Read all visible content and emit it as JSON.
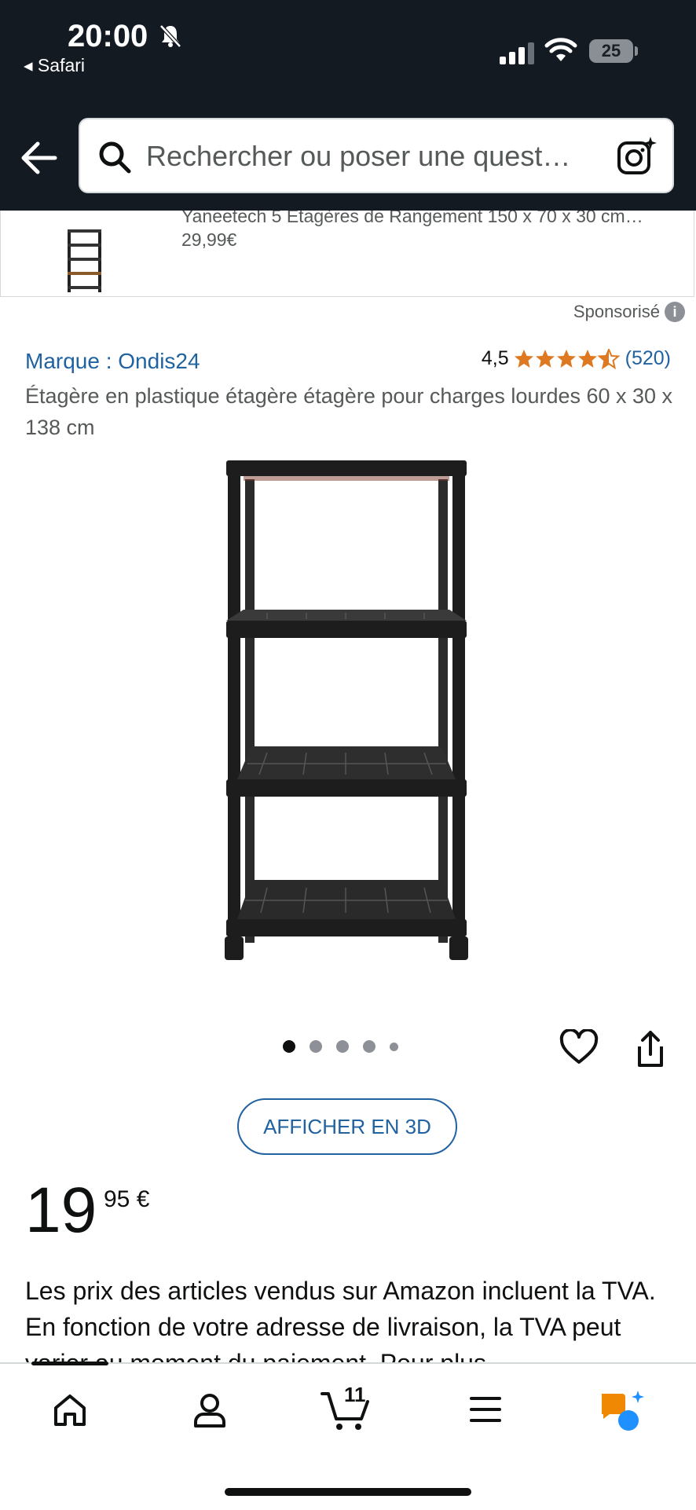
{
  "status_bar": {
    "time": "20:00",
    "back_app": "◂ Safari",
    "battery": "25"
  },
  "header": {
    "search_placeholder": "Rechercher ou poser une quest…"
  },
  "sponsored_strip": {
    "title": "Yaneetech 5 Etagères de Rangement 150 x 70 x 30 cm…",
    "price": "29,99€"
  },
  "sponsored_label": "Sponsorisé",
  "product": {
    "brand": "Marque : Ondis24",
    "rating_value": "4,5",
    "rating_stars": 4.5,
    "rating_count": "(520)",
    "title": "Étagère en plastique étagère étagère pour charges lourdes 60 x 30 x 138 cm",
    "image_count": 5,
    "active_image_index": 0,
    "view_3d_label": "AFFICHER EN 3D",
    "price_whole": "19",
    "price_fraction": "95 €",
    "tax_note": "Les prix des articles vendus sur Amazon incluent la TVA. En fonction de votre adresse de livraison, la TVA peut varier au moment du paiement. Pour plus"
  },
  "bottom_nav": {
    "cart_count": "11"
  },
  "colors": {
    "header_bg": "#131a22",
    "link": "#2162a1",
    "star": "#de7921",
    "rufus_orange": "#f08804",
    "rufus_blue": "#1e90ff"
  },
  "icons": {
    "nav_back": "arrow-left-icon",
    "search": "search-icon",
    "camera": "camera-lens-icon",
    "heart": "heart-icon",
    "share": "share-icon",
    "home": "home-icon",
    "account": "user-icon",
    "cart": "cart-icon",
    "menu": "menu-icon",
    "rufus": "rufus-chat-icon"
  }
}
